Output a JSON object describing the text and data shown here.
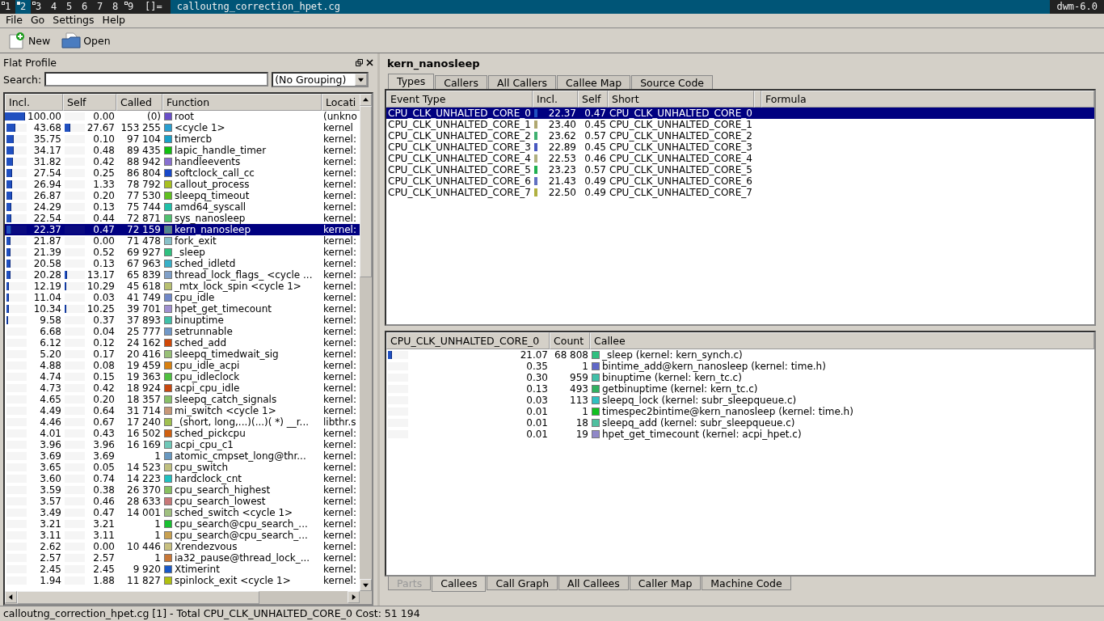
{
  "wm_bar": {
    "tags": [
      {
        "label": "1",
        "occupied": true,
        "selected": false
      },
      {
        "label": "2",
        "occupied": true,
        "selected": true
      },
      {
        "label": "3",
        "occupied": true,
        "selected": false
      },
      {
        "label": "4",
        "occupied": false,
        "selected": false
      },
      {
        "label": "5",
        "occupied": false,
        "selected": false
      },
      {
        "label": "6",
        "occupied": false,
        "selected": false
      },
      {
        "label": "7",
        "occupied": false,
        "selected": false
      },
      {
        "label": "8",
        "occupied": false,
        "selected": false
      },
      {
        "label": "9",
        "occupied": true,
        "selected": false
      }
    ],
    "layout": "[]=",
    "title": "calloutng_correction_hpet.cg",
    "status": "dwm-6.0"
  },
  "menu": [
    "File",
    "Go",
    "Settings",
    "Help"
  ],
  "toolbar": [
    {
      "kind": "new",
      "label": "New"
    },
    {
      "kind": "open",
      "label": "Open"
    }
  ],
  "flat_profile": {
    "title": "Flat Profile",
    "search_label": "Search:",
    "grouping": "(No Grouping)",
    "columns": [
      "Incl.",
      "Self",
      "Called",
      "Function",
      "Locati"
    ],
    "rows": [
      {
        "incl": "100.00",
        "incl_bar": {
          "level": 1.0
        },
        "self": "0.00",
        "called": "(0)",
        "function": "root",
        "location": "(unkno",
        "color": "#6a4fc8",
        "selected": false
      },
      {
        "incl": "43.68",
        "incl_bar": {
          "level": 0.4368
        },
        "self": "27.67",
        "self_bar": {
          "level": 0.2767
        },
        "called": "153 255",
        "function": "<cycle 1>",
        "location": "kernel",
        "color": "#2a9fd0",
        "selected": false
      },
      {
        "incl": "35.75",
        "incl_bar": {
          "level": 0.3575
        },
        "self": "0.10",
        "called": "97 104",
        "function": "timercb",
        "location": "kernel:",
        "color": "#1aa0c8",
        "selected": false
      },
      {
        "incl": "34.17",
        "incl_bar": {
          "level": 0.3417
        },
        "self": "0.48",
        "called": "89 435",
        "function": "lapic_handle_timer",
        "location": "kernel:",
        "color": "#10c010",
        "selected": false
      },
      {
        "incl": "31.82",
        "incl_bar": {
          "level": 0.3182
        },
        "self": "0.42",
        "called": "88 942",
        "function": "handleevents",
        "location": "kernel:",
        "color": "#8870d0",
        "selected": false
      },
      {
        "incl": "27.54",
        "incl_bar": {
          "level": 0.2754
        },
        "self": "0.25",
        "called": "86 804",
        "function": "softclock_call_cc",
        "location": "kernel:",
        "color": "#1848c8",
        "selected": false
      },
      {
        "incl": "26.94",
        "incl_bar": {
          "level": 0.2694
        },
        "self": "1.33",
        "called": "78 792",
        "function": "callout_process",
        "location": "kernel:",
        "color": "#a8c020",
        "selected": false
      },
      {
        "incl": "26.87",
        "incl_bar": {
          "level": 0.2687
        },
        "self": "0.20",
        "called": "77 530",
        "function": "sleepq_timeout",
        "location": "kernel:",
        "color": "#60c020",
        "selected": false
      },
      {
        "incl": "24.29",
        "incl_bar": {
          "level": 0.2429
        },
        "self": "0.13",
        "called": "75 744",
        "function": "amd64_syscall",
        "location": "kernel:",
        "color": "#20c0a8",
        "selected": false
      },
      {
        "incl": "22.54",
        "incl_bar": {
          "level": 0.2254
        },
        "self": "0.44",
        "called": "72 871",
        "function": "sys_nanosleep",
        "location": "kernel:",
        "color": "#50c070",
        "selected": false
      },
      {
        "incl": "22.37",
        "incl_bar": {
          "level": 0.2237
        },
        "self": "0.47",
        "called": "72 159",
        "function": "kern_nanosleep",
        "location": "kernel:",
        "color": "#508890",
        "selected": true
      },
      {
        "incl": "21.87",
        "incl_bar": {
          "level": 0.2187
        },
        "self": "0.00",
        "called": "71 478",
        "function": "fork_exit",
        "location": "kernel:",
        "color": "#88c0c8",
        "selected": false
      },
      {
        "incl": "21.39",
        "incl_bar": {
          "level": 0.2139
        },
        "self": "0.52",
        "called": "69 927",
        "function": "_sleep",
        "location": "kernel:",
        "color": "#30c080",
        "selected": false
      },
      {
        "incl": "20.58",
        "incl_bar": {
          "level": 0.2058
        },
        "self": "0.13",
        "called": "67 963",
        "function": "sched_idletd",
        "location": "kernel:",
        "color": "#38b0c8",
        "selected": false
      },
      {
        "incl": "20.28",
        "incl_bar": {
          "level": 0.2028
        },
        "self": "13.17",
        "self_bar": {
          "level": 0.1317
        },
        "called": "65 839",
        "function": "thread_lock_flags_ <cycle ...",
        "location": "kernel:",
        "color": "#80a0c8",
        "selected": false
      },
      {
        "incl": "12.19",
        "incl_bar": {
          "level": 0.1219
        },
        "self": "10.29",
        "self_bar": {
          "level": 0.1029
        },
        "called": "45 618",
        "function": "_mtx_lock_spin <cycle 1>",
        "location": "kernel:",
        "color": "#b8c070",
        "selected": false
      },
      {
        "incl": "11.04",
        "incl_bar": {
          "level": 0.1104
        },
        "self": "0.03",
        "called": "41 749",
        "function": "cpu_idle",
        "location": "kernel:",
        "color": "#7088c8",
        "selected": false
      },
      {
        "incl": "10.34",
        "incl_bar": {
          "level": 0.1034
        },
        "self": "10.25",
        "self_bar": {
          "level": 0.1025
        },
        "called": "39 701",
        "function": "hpet_get_timecount",
        "location": "kernel:",
        "color": "#a090d0",
        "selected": false
      },
      {
        "incl": "9.58",
        "incl_bar": {
          "level": 0.0958
        },
        "self": "0.37",
        "called": "37 893",
        "function": "binuptime",
        "location": "kernel:",
        "color": "#40c0a8",
        "selected": false
      },
      {
        "incl": "6.68",
        "self": "0.04",
        "called": "25 777",
        "function": "setrunnable",
        "location": "kernel:",
        "color": "#7098c8",
        "selected": false
      },
      {
        "incl": "6.12",
        "self": "0.12",
        "called": "24 162",
        "function": "sched_add",
        "location": "kernel:",
        "color": "#d04808",
        "selected": false
      },
      {
        "incl": "5.20",
        "self": "0.17",
        "called": "20 416",
        "function": "sleepq_timedwait_sig",
        "location": "kernel:",
        "color": "#98c078",
        "selected": false
      },
      {
        "incl": "4.88",
        "self": "0.08",
        "called": "19 459",
        "function": "cpu_idle_acpi",
        "location": "kernel:",
        "color": "#d88010",
        "selected": false
      },
      {
        "incl": "4.74",
        "self": "0.15",
        "called": "19 363",
        "function": "cpu_idleclock",
        "location": "kernel:",
        "color": "#50c040",
        "selected": false
      },
      {
        "incl": "4.73",
        "self": "0.42",
        "called": "18 924",
        "function": "acpi_cpu_idle",
        "location": "kernel:",
        "color": "#c84810",
        "selected": false
      },
      {
        "incl": "4.65",
        "self": "0.20",
        "called": "18 357",
        "function": "sleepq_catch_signals",
        "location": "kernel:",
        "color": "#88c068",
        "selected": false
      },
      {
        "incl": "4.49",
        "self": "0.64",
        "called": "31 714",
        "function": "mi_switch <cycle 1>",
        "location": "kernel:",
        "color": "#c89878",
        "selected": false
      },
      {
        "incl": "4.46",
        "self": "0.67",
        "called": "17 240",
        "function": "_(short, long,...)(...)( *) __r...",
        "location": "libthr.s",
        "color": "#a0c050",
        "selected": false
      },
      {
        "incl": "4.01",
        "self": "0.43",
        "called": "16 502",
        "function": "sched_pickcpu",
        "location": "kernel:",
        "color": "#d06010",
        "selected": false
      },
      {
        "incl": "3.96",
        "self": "3.96",
        "called": "16 169",
        "function": "acpi_cpu_c1",
        "location": "kernel:",
        "color": "#70c8b8",
        "selected": false
      },
      {
        "incl": "3.69",
        "self": "3.69",
        "called": "1",
        "function": "atomic_cmpset_long@thr...",
        "location": "kernel:",
        "color": "#6898c0",
        "selected": false
      },
      {
        "incl": "3.65",
        "self": "0.05",
        "called": "14 523",
        "function": "cpu_switch",
        "location": "kernel:",
        "color": "#c0c080",
        "selected": false
      },
      {
        "incl": "3.60",
        "self": "0.74",
        "called": "14 223",
        "function": "hardclock_cnt",
        "location": "kernel:",
        "color": "#20c0c0",
        "selected": false
      },
      {
        "incl": "3.59",
        "self": "0.38",
        "called": "26 370",
        "function": "cpu_search_highest",
        "location": "kernel:",
        "color": "#88c060",
        "selected": false
      },
      {
        "incl": "3.57",
        "self": "0.46",
        "called": "28 633",
        "function": "cpu_search_lowest",
        "location": "kernel:",
        "color": "#c87878",
        "selected": false
      },
      {
        "incl": "3.49",
        "self": "0.47",
        "called": "14 001",
        "function": "sched_switch <cycle 1>",
        "location": "kernel:",
        "color": "#a0c080",
        "selected": false
      },
      {
        "incl": "3.21",
        "self": "3.21",
        "called": "1",
        "function": "cpu_search@cpu_search_...",
        "location": "kernel:",
        "color": "#18c030",
        "selected": false
      },
      {
        "incl": "3.11",
        "self": "3.11",
        "called": "1",
        "function": "cpu_search@cpu_search_...",
        "location": "kernel:",
        "color": "#c8a050",
        "selected": false
      },
      {
        "incl": "2.62",
        "self": "0.00",
        "called": "10 446",
        "function": "Xrendezvous",
        "location": "kernel:",
        "color": "#c8c080",
        "selected": false
      },
      {
        "incl": "2.57",
        "self": "2.57",
        "called": "1",
        "function": "ia32_pause@thread_lock_...",
        "location": "kernel:",
        "color": "#c87838",
        "selected": false
      },
      {
        "incl": "2.45",
        "self": "2.45",
        "called": "9 920",
        "function": "Xtimerint",
        "location": "kernel:",
        "color": "#1858c8",
        "selected": false
      },
      {
        "incl": "1.94",
        "self": "1.88",
        "called": "11 827",
        "function": "spinlock_exit <cycle 1>",
        "location": "kernel:",
        "color": "#b0c010",
        "selected": false
      }
    ]
  },
  "detail": {
    "title": "kern_nanosleep",
    "top_tabs": [
      {
        "label": "Types",
        "selected": true
      },
      {
        "label": "Callers",
        "selected": false
      },
      {
        "label": "All Callers",
        "selected": false
      },
      {
        "label": "Callee Map",
        "selected": false
      },
      {
        "label": "Source Code",
        "selected": false
      }
    ],
    "types_columns": [
      "Event Type",
      "Incl.",
      "Self",
      "Short",
      "Formula"
    ],
    "types": [
      {
        "event": "CPU_CLK_UNHALTED_CORE_0",
        "color": "#2050c0",
        "incl": "22.37",
        "self": "0.47",
        "short": "CPU_CLK_UNHALTED_CORE_0",
        "selected": true
      },
      {
        "event": "CPU_CLK_UNHALTED_CORE_1",
        "color": "#b0a870",
        "incl": "23.40",
        "self": "0.45",
        "short": "CPU_CLK_UNHALTED_CORE_1",
        "selected": false
      },
      {
        "event": "CPU_CLK_UNHALTED_CORE_2",
        "color": "#40b070",
        "incl": "23.62",
        "self": "0.57",
        "short": "CPU_CLK_UNHALTED_CORE_2",
        "selected": false
      },
      {
        "event": "CPU_CLK_UNHALTED_CORE_3",
        "color": "#4858c0",
        "incl": "22.89",
        "self": "0.45",
        "short": "CPU_CLK_UNHALTED_CORE_3",
        "selected": false
      },
      {
        "event": "CPU_CLK_UNHALTED_CORE_4",
        "color": "#b0b080",
        "incl": "22.53",
        "self": "0.46",
        "short": "CPU_CLK_UNHALTED_CORE_4",
        "selected": false
      },
      {
        "event": "CPU_CLK_UNHALTED_CORE_5",
        "color": "#20b050",
        "incl": "23.23",
        "self": "0.57",
        "short": "CPU_CLK_UNHALTED_CORE_5",
        "selected": false
      },
      {
        "event": "CPU_CLK_UNHALTED_CORE_6",
        "color": "#6070c0",
        "incl": "21.43",
        "self": "0.49",
        "short": "CPU_CLK_UNHALTED_CORE_6",
        "selected": false
      },
      {
        "event": "CPU_CLK_UNHALTED_CORE_7",
        "color": "#b0b040",
        "incl": "22.50",
        "self": "0.49",
        "short": "CPU_CLK_UNHALTED_CORE_7",
        "selected": false
      }
    ],
    "callee_columns": [
      "CPU_CLK_UNHALTED_CORE_0",
      "Count",
      "Callee"
    ],
    "callees": [
      {
        "cost": "21.07",
        "bar": {
          "level": 0.2107
        },
        "count": "68 808",
        "callee": "_sleep (kernel: kern_synch.c)",
        "color": "#30c080"
      },
      {
        "cost": "0.35",
        "count": "1",
        "callee": "bintime_add@kern_nanosleep (kernel: time.h)",
        "color": "#6068c8"
      },
      {
        "cost": "0.30",
        "count": "959",
        "callee": "binuptime (kernel: kern_tc.c)",
        "color": "#40c0a8"
      },
      {
        "cost": "0.13",
        "count": "493",
        "callee": "getbinuptime (kernel: kern_tc.c)",
        "color": "#30b060"
      },
      {
        "cost": "0.03",
        "count": "113",
        "callee": "sleepq_lock (kernel: subr_sleepqueue.c)",
        "color": "#30c0c0"
      },
      {
        "cost": "0.01",
        "count": "1",
        "callee": "timespec2bintime@kern_nanosleep (kernel: time.h)",
        "color": "#10c020"
      },
      {
        "cost": "0.01",
        "count": "18",
        "callee": "sleepq_add (kernel: subr_sleepqueue.c)",
        "color": "#50c0a0"
      },
      {
        "cost": "0.01",
        "count": "19",
        "callee": "hpet_get_timecount (kernel: acpi_hpet.c)",
        "color": "#9088c8"
      }
    ],
    "bottom_tabs": [
      {
        "label": "Parts",
        "selected": false,
        "disabled": true
      },
      {
        "label": "Callees",
        "selected": true,
        "disabled": false
      },
      {
        "label": "Call Graph",
        "selected": false,
        "disabled": false
      },
      {
        "label": "All Callees",
        "selected": false,
        "disabled": false
      },
      {
        "label": "Caller Map",
        "selected": false,
        "disabled": false
      },
      {
        "label": "Machine Code",
        "selected": false,
        "disabled": false
      }
    ]
  },
  "status_bar": "calloutng_correction_hpet.cg [1] - Total CPU_CLK_UNHALTED_CORE_0 Cost: 51 194"
}
